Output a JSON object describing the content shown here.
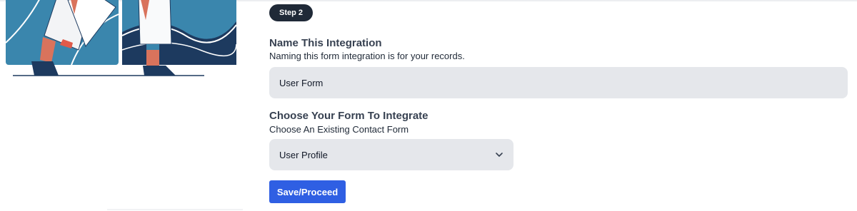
{
  "step": {
    "badge": "Step 2"
  },
  "name_section": {
    "title": "Name This Integration",
    "description": "Naming this form integration is for your records.",
    "input_value": "User Form"
  },
  "form_section": {
    "title": "Choose Your Form To Integrate",
    "description": "Choose An Existing Contact Form",
    "selected_option": "User Profile"
  },
  "actions": {
    "save_label": "Save/Proceed"
  },
  "colors": {
    "accent": "#2f5fe3",
    "badge_bg": "#1f2937",
    "field_bg": "#e5e7eb",
    "illustration_light": "#3a86ad",
    "illustration_dark": "#1d3a5f",
    "illustration_skin": "#d9735c"
  },
  "icons": {
    "illustration": "people-walking-illustration",
    "select_chevron": "chevron-down-icon"
  }
}
